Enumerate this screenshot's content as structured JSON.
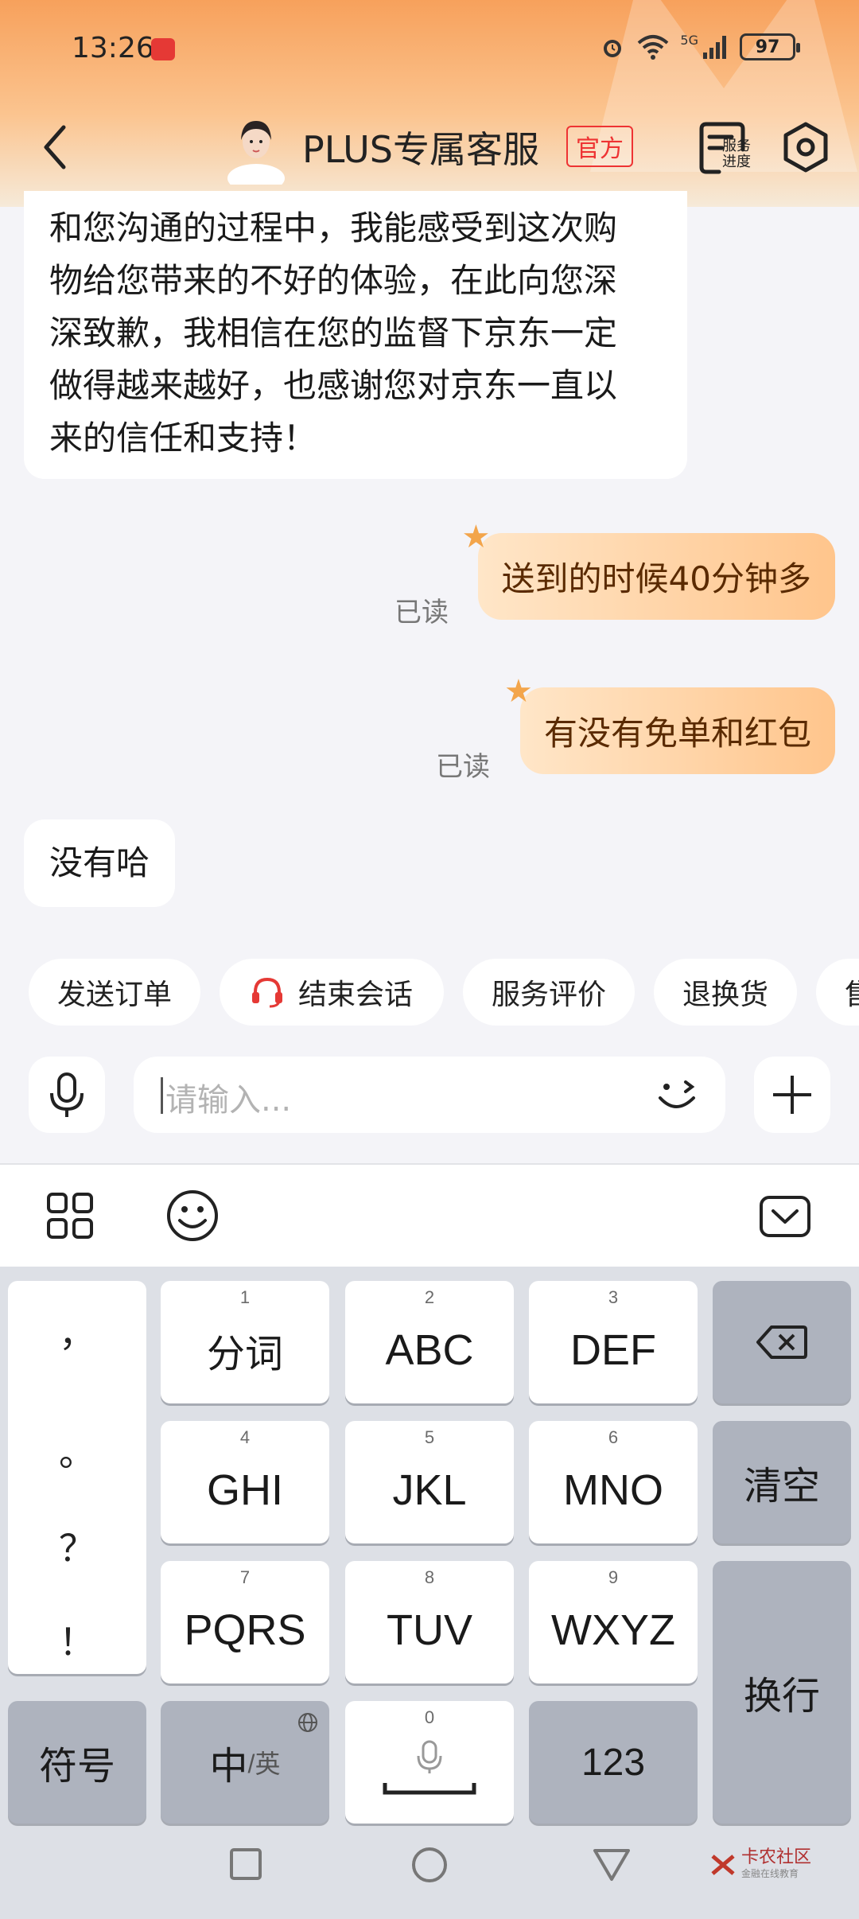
{
  "status_bar": {
    "time": "13:26",
    "network": "5G",
    "battery": "97"
  },
  "nav": {
    "title": "PLUS专属客服",
    "badge": "官方",
    "progress_label": "服务进度"
  },
  "messages": {
    "agent_long": [
      "和您沟通的过程中，我能感受到这次购",
      "物给您带来的不好的体验，在此向您深",
      "深致歉，我相信在您的监督下京东一定",
      "做得越来越好，也感谢您对京东一直以",
      "来的信任和支持！"
    ],
    "user_1": "送到的时候40分钟多",
    "user_2": "有没有免单和红包",
    "read_status": "已读",
    "agent_reply": "没有哈"
  },
  "quick_actions": [
    "发送订单",
    "结束会话",
    "服务评价",
    "退换货",
    "售"
  ],
  "input": {
    "placeholder": "请输入..."
  },
  "keyboard": {
    "punct": [
      "，",
      "。",
      "？",
      "！"
    ],
    "keys": {
      "k1": {
        "num": "1",
        "label": "分词"
      },
      "k2": {
        "num": "2",
        "label": "ABC"
      },
      "k3": {
        "num": "3",
        "label": "DEF"
      },
      "k4": {
        "num": "4",
        "label": "GHI"
      },
      "k5": {
        "num": "5",
        "label": "JKL"
      },
      "k6": {
        "num": "6",
        "label": "MNO"
      },
      "k7": {
        "num": "7",
        "label": "PQRS"
      },
      "k8": {
        "num": "8",
        "label": "TUV"
      },
      "k9": {
        "num": "9",
        "label": "WXYZ"
      },
      "k0": {
        "num": "0"
      }
    },
    "clear": "清空",
    "enter": "换行",
    "symbols": "符号",
    "lang_main": "中",
    "lang_alt": "/英",
    "numbers": "123"
  },
  "watermark": {
    "name": "卡农社区",
    "sub": "金融在线教育"
  },
  "colors": {
    "header_orange": "#f7a15c",
    "user_bubble": "#ffc58c",
    "official_red": "#e33333",
    "headset_red": "#e53935"
  }
}
